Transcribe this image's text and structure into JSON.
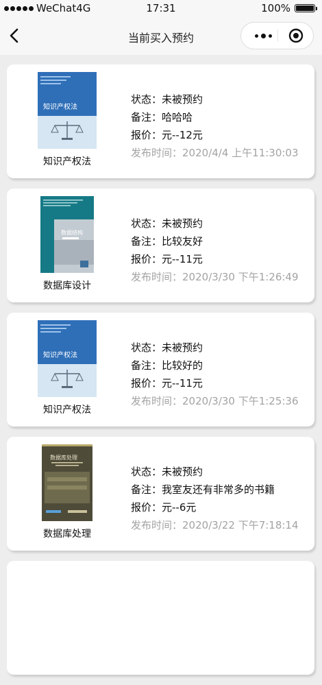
{
  "status_bar": {
    "carrier": "WeChat4G",
    "time": "17:31",
    "battery": "100%",
    "signal_icon": "signal-dots-icon",
    "wifi_icon": "wifi-icon",
    "battery_icon": "battery-icon"
  },
  "nav": {
    "title": "当前买入预约",
    "back_icon": "chevron-left-icon",
    "more_icon": "more-dots-icon",
    "close_icon": "target-circle-icon"
  },
  "items": [
    {
      "book_name": "知识产权法",
      "cover_icon": "book-cover-ip-law",
      "status_label": "状态：",
      "status": "未被预约",
      "note_label": "备注：",
      "note": "哈哈哈",
      "price_label": "报价：",
      "price": "元--12元",
      "time_label": "发布时间：",
      "time": "2020/4/4 上午11:30:03"
    },
    {
      "book_name": "数据库设计",
      "cover_icon": "book-cover-data-structures",
      "status_label": "状态：",
      "status": "未被预约",
      "note_label": "备注：",
      "note": "比较友好",
      "price_label": "报价：",
      "price": "元--11元",
      "time_label": "发布时间：",
      "time": "2020/3/30 下午1:26:49"
    },
    {
      "book_name": "知识产权法",
      "cover_icon": "book-cover-ip-law",
      "status_label": "状态：",
      "status": "未被预约",
      "note_label": "备注：",
      "note": "比较好的",
      "price_label": "报价：",
      "price": "元--11元",
      "time_label": "发布时间：",
      "time": "2020/3/30 下午1:25:36"
    },
    {
      "book_name": "数据库处理",
      "cover_icon": "book-cover-database-processing",
      "status_label": "状态：",
      "status": "未被预约",
      "note_label": "备注：",
      "note": "我室友还有非常多的书籍",
      "price_label": "报价：",
      "price": "元--6元",
      "time_label": "发布时间：",
      "time": "2020/3/22 下午7:18:14"
    }
  ],
  "cover_text": {
    "ip_law_title": "知识产权法",
    "data_structures_title": "数据结构",
    "database_processing_title": "数据库处理"
  },
  "colors": {
    "background": "#ededed",
    "card": "#ffffff",
    "muted_text": "#a3a3a3",
    "ip_law_cover": "#2f6fb8",
    "data_structures_cover": "#167a86",
    "database_processing_cover": "#4e4b39"
  }
}
